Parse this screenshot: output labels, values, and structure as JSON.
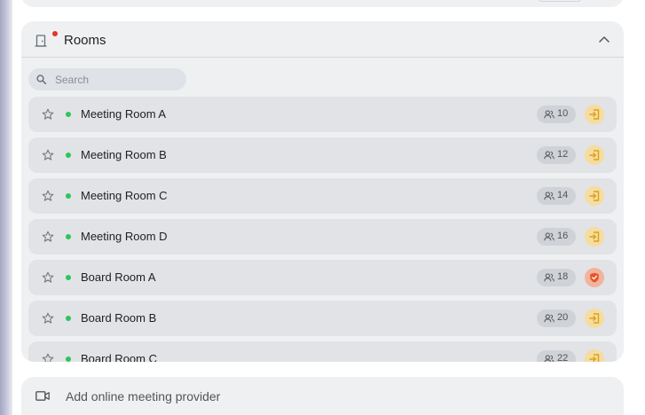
{
  "rooms_panel": {
    "title": "Rooms",
    "search": {
      "placeholder": "Search",
      "value": ""
    },
    "rooms": [
      {
        "name": "Meeting Room A",
        "capacity": "10",
        "status": "available",
        "action": "join"
      },
      {
        "name": "Meeting Room B",
        "capacity": "12",
        "status": "available",
        "action": "join"
      },
      {
        "name": "Meeting Room C",
        "capacity": "14",
        "status": "available",
        "action": "join"
      },
      {
        "name": "Meeting Room D",
        "capacity": "16",
        "status": "available",
        "action": "join"
      },
      {
        "name": "Board Room A",
        "capacity": "18",
        "status": "available",
        "action": "secure"
      },
      {
        "name": "Board Room B",
        "capacity": "20",
        "status": "available",
        "action": "join"
      },
      {
        "name": "Board Room C",
        "capacity": "22",
        "status": "available",
        "action": "join"
      }
    ]
  },
  "meeting_provider": {
    "label": "Add online meeting provider"
  },
  "colors": {
    "available_dot": "#2ec55b",
    "notification_dot": "#e5352b",
    "join_button": "#f6dc9e",
    "join_icon": "#d9a21c",
    "secure_button": "#f1b49d",
    "secure_icon": "#e8552a"
  },
  "icons": [
    "door-icon",
    "chevron-up-icon",
    "search-icon",
    "star-icon",
    "people-icon",
    "join-icon",
    "shield-check-icon",
    "video-camera-icon"
  ]
}
